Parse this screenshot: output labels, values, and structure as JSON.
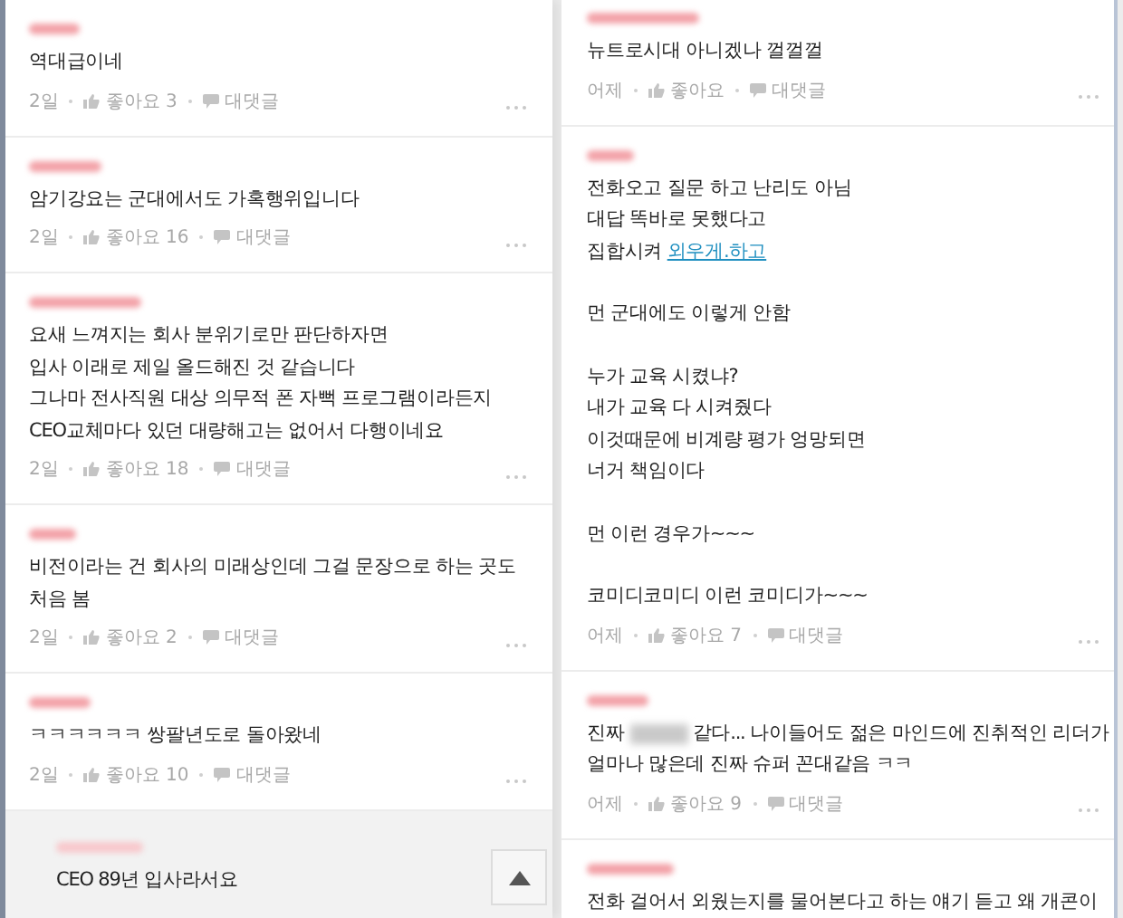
{
  "panels": [
    {
      "scroll_top_button": true,
      "comments": [
        {
          "username_redacted": true,
          "highlighted": false,
          "paragraphs": [
            [
              "역대급이네"
            ]
          ],
          "time": "2일",
          "likes": "좋아요 3",
          "reply": "대댓글"
        },
        {
          "username_redacted": true,
          "highlighted": false,
          "paragraphs": [
            [
              "암기강요는 군대에서도 가혹행위입니다"
            ]
          ],
          "time": "2일",
          "likes": "좋아요 16",
          "reply": "대댓글"
        },
        {
          "username_redacted": true,
          "highlighted": false,
          "paragraphs": [
            [
              "요새 느껴지는 회사 분위기로만 판단하자면",
              "입사 이래로 제일 올드해진 것 같습니다",
              "그나마 전사직원 대상 의무적 폰 자뻑 프로그램이라든지",
              "CEO교체마다 있던 대량해고는 없어서 다행이네요"
            ]
          ],
          "time": "2일",
          "likes": "좋아요 18",
          "reply": "대댓글"
        },
        {
          "username_redacted": true,
          "highlighted": false,
          "paragraphs": [
            [
              "비전이라는 건 회사의 미래상인데 그걸 문장으로 하는 곳도",
              "처음 봄"
            ]
          ],
          "time": "2일",
          "likes": "좋아요 2",
          "reply": "대댓글"
        },
        {
          "username_redacted": true,
          "highlighted": false,
          "paragraphs": [
            [
              "ㅋㅋㅋㅋㅋㅋ 쌍팔년도로 돌아왔네"
            ]
          ],
          "time": "2일",
          "likes": "좋아요 10",
          "reply": "대댓글"
        },
        {
          "username_redacted": true,
          "highlighted": true,
          "paragraphs": [
            [
              "CEO 89년 입사라서요"
            ]
          ]
        }
      ]
    },
    {
      "comments": [
        {
          "username_redacted": true,
          "highlighted": false,
          "paragraphs": [
            [
              "뉴트로시대 아니겠나 껄껄껄"
            ]
          ],
          "time": "어제",
          "likes": "좋아요",
          "reply": "대댓글"
        },
        {
          "username_redacted": true,
          "highlighted": false,
          "paragraphs": [
            [
              "전화오고 질문 하고 난리도 아님",
              "대답 똑바로 못했다고",
              {
                "segments": [
                  {
                    "text": "집합시켜 "
                  },
                  {
                    "kind": "link",
                    "text": "외우게.하고"
                  }
                ]
              }
            ],
            [
              "먼 군대에도 이렇게 안함"
            ],
            [
              "누가 교육 시켰냐?",
              "내가 교육 다 시켜줬다",
              "이것때문에 비계량 평가 엉망되면",
              "너거 책임이다"
            ],
            [
              "먼 이런 경우가~~~"
            ],
            [
              "코미디코미디 이런 코미디가~~~"
            ]
          ],
          "time": "어제",
          "likes": "좋아요 7",
          "reply": "대댓글"
        },
        {
          "username_redacted": true,
          "highlighted": false,
          "paragraphs": [
            [
              {
                "segments": [
                  {
                    "text": "진짜 "
                  },
                  {
                    "kind": "redacted"
                  },
                  {
                    "text": " 같다... 나이들어도 젊은 마인드에 진취적인 리더가"
                  }
                ]
              },
              "얼마나 많은데 진짜 슈퍼 꼰대같음 ㅋㅋ"
            ]
          ],
          "time": "어제",
          "likes": "좋아요 9",
          "reply": "대댓글"
        },
        {
          "username_redacted": true,
          "highlighted": false,
          "paragraphs": [
            [
              "전화 걸어서 외웠는지를 물어본다고 하는 얘기 듣고 왜 개콘이"
            ]
          ]
        }
      ]
    }
  ]
}
